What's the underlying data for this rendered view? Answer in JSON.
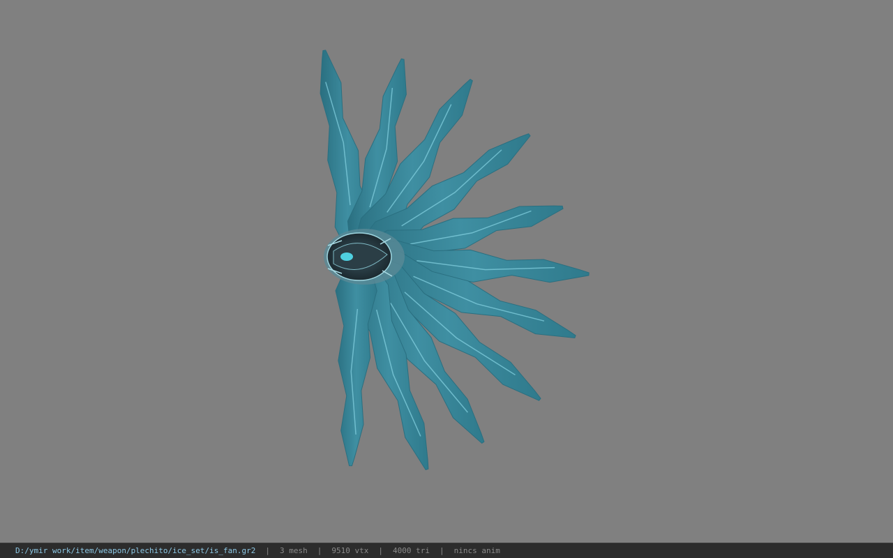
{
  "viewer": {
    "background_color": "#808080",
    "model_name": "ice-fan-model",
    "model_colors": {
      "blade_dark": "#2a6f80",
      "blade_mid": "#3f8fa2",
      "blade_light": "#86d3e2",
      "hub_dark": "#23343c",
      "hub_glow": "#4fd0e0"
    }
  },
  "status": {
    "file_path": "D:/ymir work/item/weapon/plechito/ice_set/is_fan.gr2",
    "separator": "|",
    "mesh": "3 mesh",
    "vertices": "9510 vtx",
    "triangles": "4000 tri",
    "anim": "nincs anim"
  }
}
